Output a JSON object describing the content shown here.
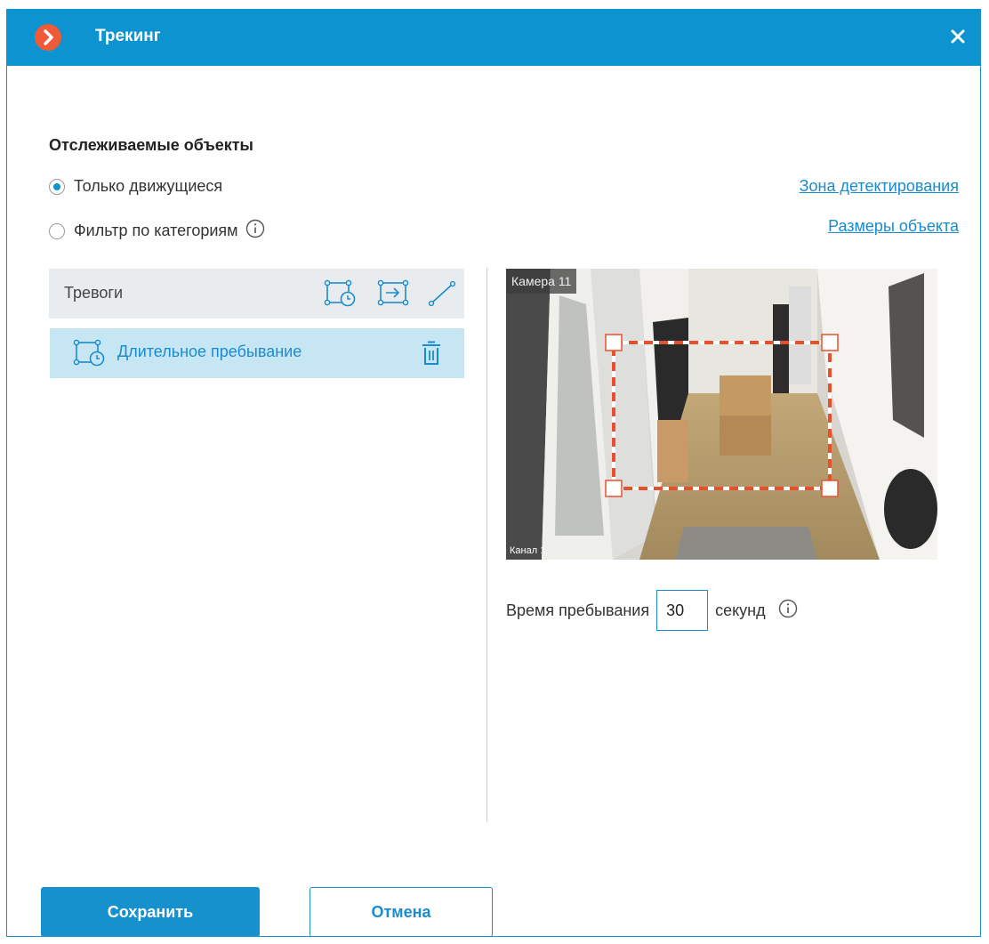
{
  "window": {
    "title": "Трекинг",
    "accent_color": "#0d93cf",
    "logo_icon": "app-logo-chevron"
  },
  "tracked_objects": {
    "heading": "Отслеживаемые объекты",
    "options": [
      {
        "label": "Только движущиеся",
        "checked": true
      },
      {
        "label": "Фильтр по категориям",
        "checked": false,
        "info_icon": "info-icon"
      }
    ]
  },
  "links": {
    "detection_zone": "Зона детектирования",
    "object_size": "Размеры объекта"
  },
  "alarms": {
    "title": "Тревоги",
    "tools": [
      "zone-timer-icon",
      "zone-enter-icon",
      "line-crossing-icon"
    ],
    "items": [
      {
        "label": "Длительное пребывание",
        "icon": "zone-timer-icon",
        "delete_icon": "trash-icon"
      }
    ]
  },
  "camera": {
    "name": "Камера 11",
    "channel": "Канал 1",
    "zone_color": "#e8502b"
  },
  "dwell": {
    "label": "Время пребывания",
    "value": "30",
    "unit": "секунд"
  },
  "buttons": {
    "save": "Сохранить",
    "cancel": "Отмена"
  }
}
